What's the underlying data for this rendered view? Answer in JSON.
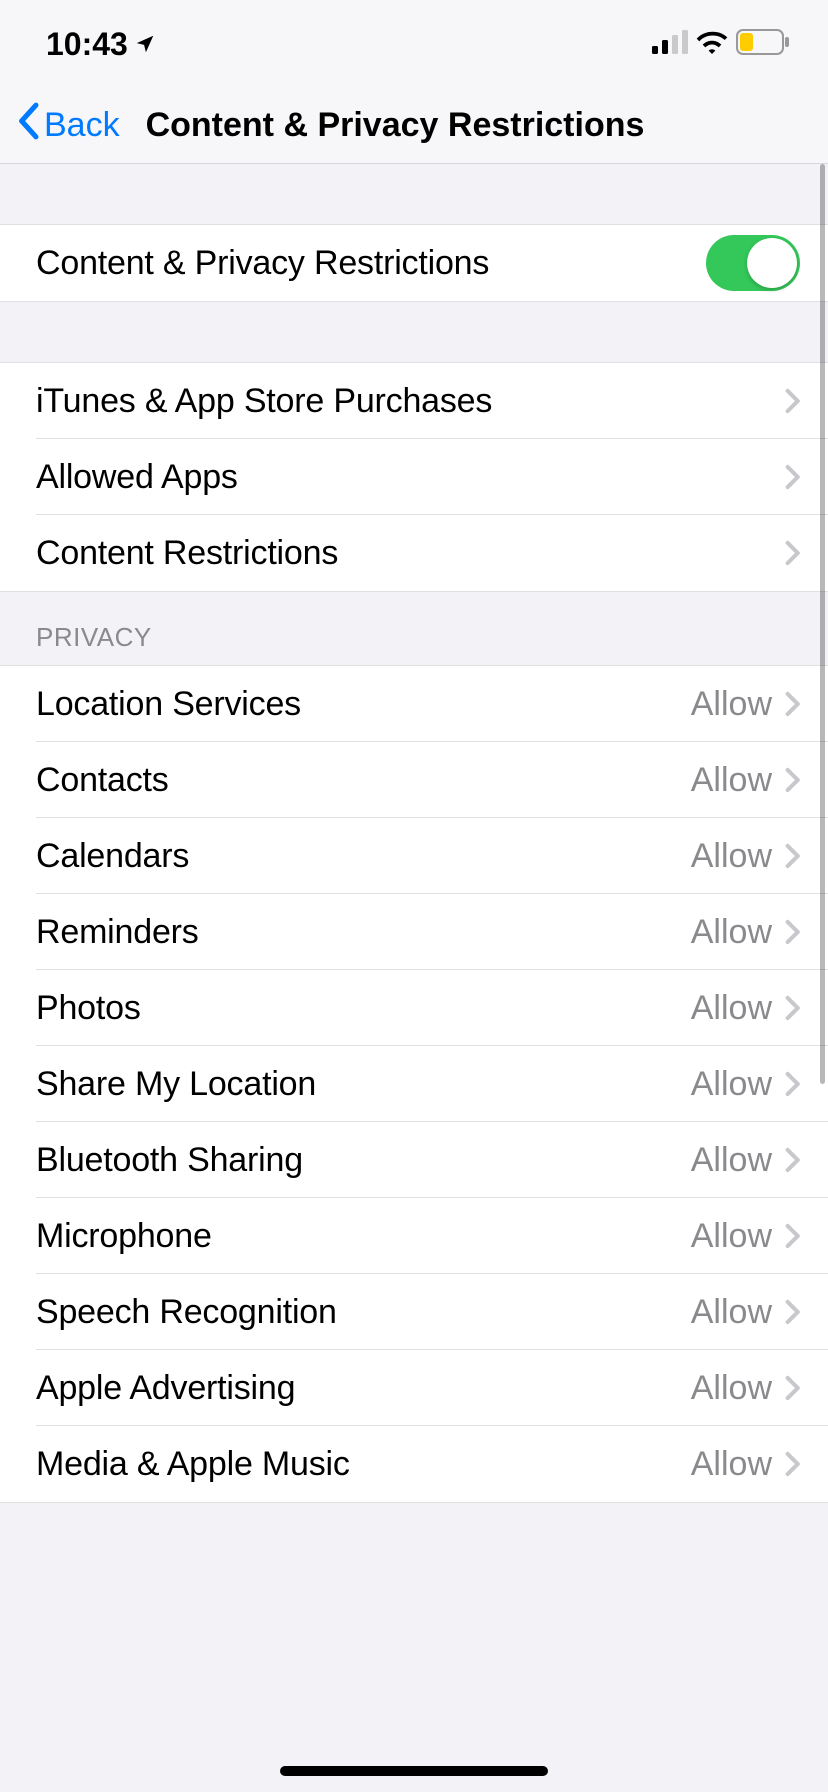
{
  "status": {
    "time": "10:43"
  },
  "nav": {
    "back": "Back",
    "title": "Content & Privacy Restrictions"
  },
  "toggle_section": {
    "label": "Content & Privacy Restrictions",
    "enabled": true
  },
  "main_section": {
    "items": [
      {
        "label": "iTunes & App Store Purchases"
      },
      {
        "label": "Allowed Apps"
      },
      {
        "label": "Content Restrictions"
      }
    ]
  },
  "privacy_section": {
    "header": "Privacy",
    "items": [
      {
        "label": "Location Services",
        "value": "Allow"
      },
      {
        "label": "Contacts",
        "value": "Allow"
      },
      {
        "label": "Calendars",
        "value": "Allow"
      },
      {
        "label": "Reminders",
        "value": "Allow"
      },
      {
        "label": "Photos",
        "value": "Allow"
      },
      {
        "label": "Share My Location",
        "value": "Allow"
      },
      {
        "label": "Bluetooth Sharing",
        "value": "Allow"
      },
      {
        "label": "Microphone",
        "value": "Allow"
      },
      {
        "label": "Speech Recognition",
        "value": "Allow"
      },
      {
        "label": "Apple Advertising",
        "value": "Allow"
      },
      {
        "label": "Media & Apple Music",
        "value": "Allow"
      }
    ]
  }
}
